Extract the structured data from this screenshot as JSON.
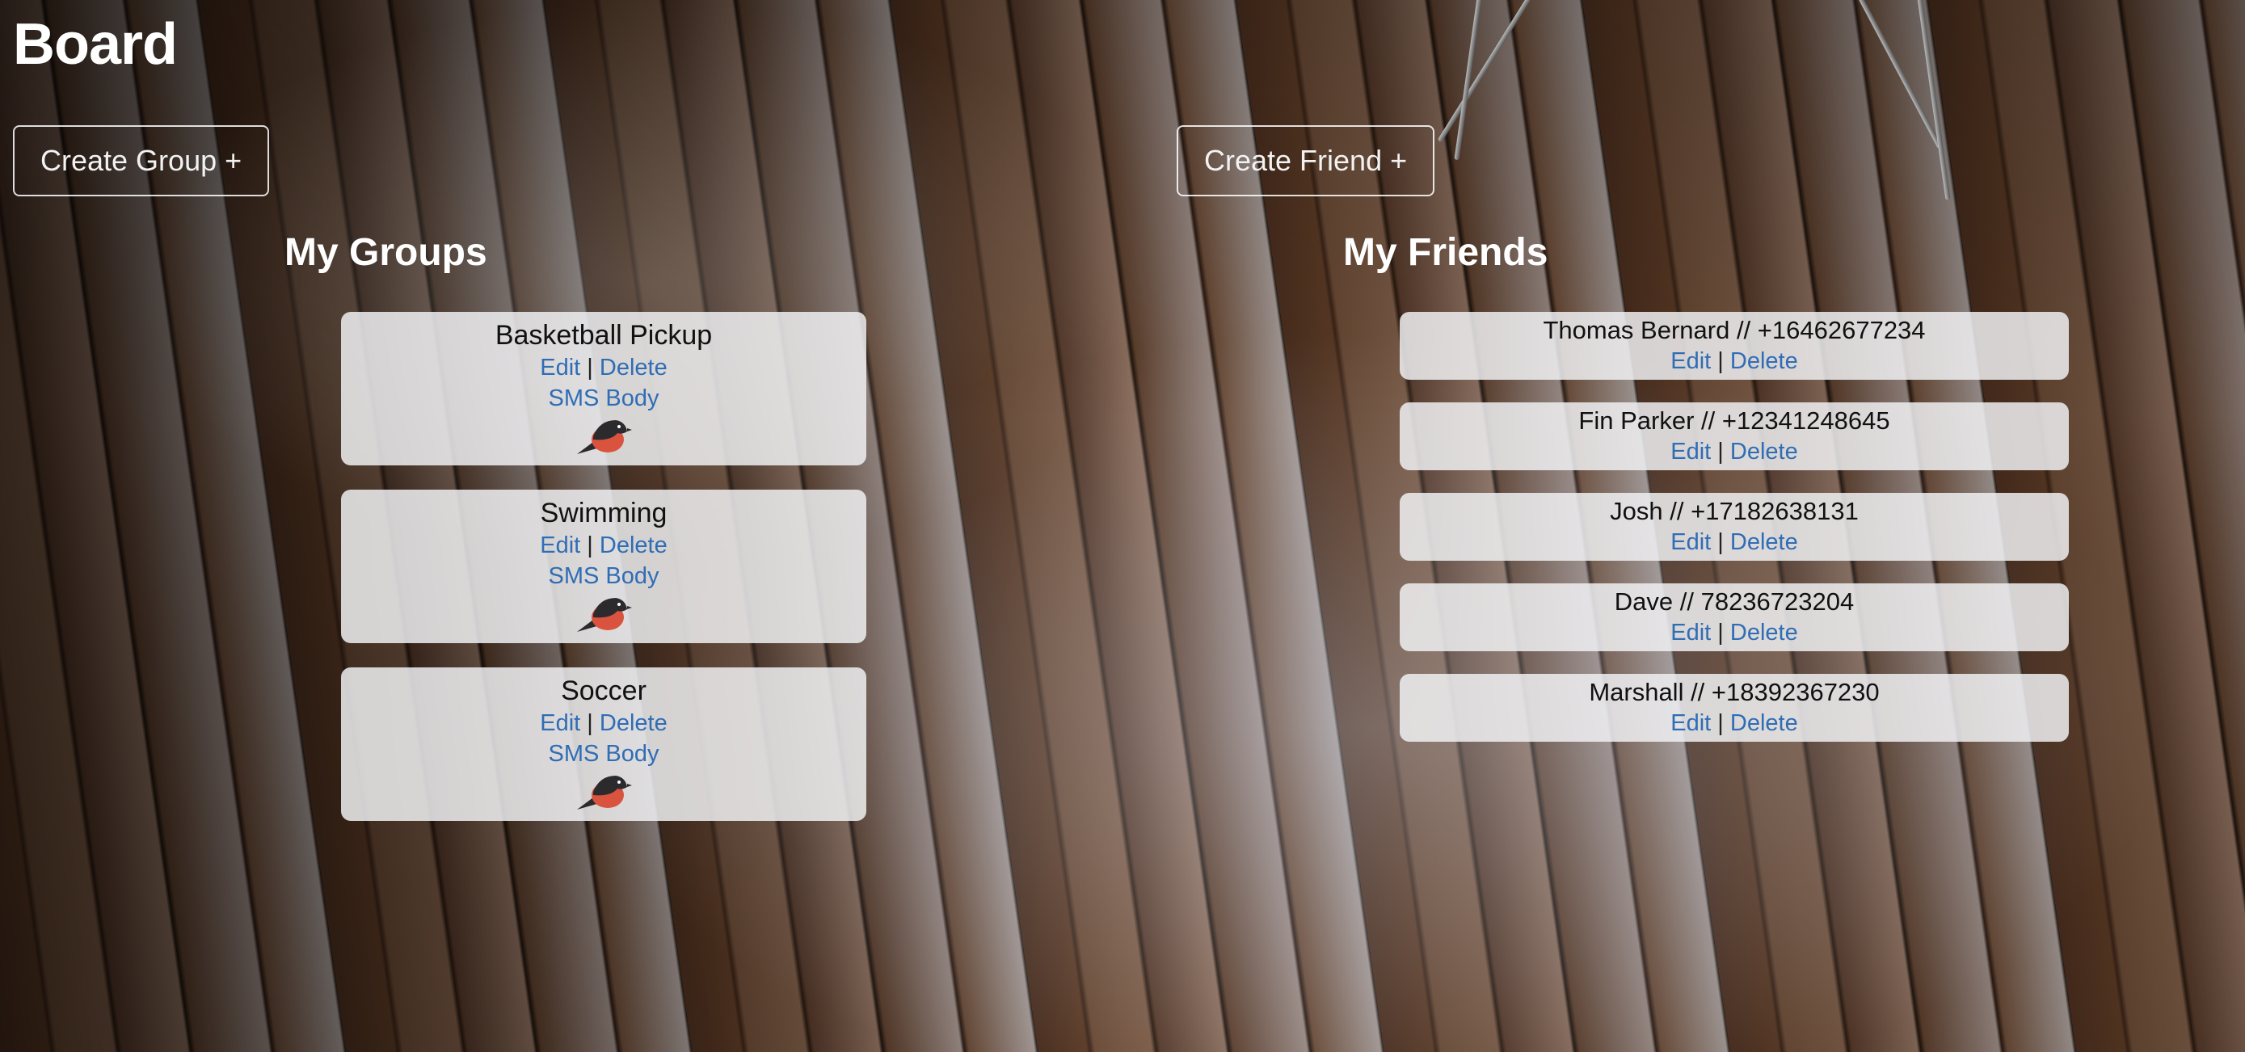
{
  "app": {
    "title": "Board"
  },
  "toolbar": {
    "create_group_label": "Create Group +",
    "create_friend_label": "Create Friend +"
  },
  "groups": {
    "heading": "My Groups",
    "items": [
      {
        "name": "Basketball Pickup",
        "edit": "Edit",
        "separator": "|",
        "delete": "Delete",
        "sms": "SMS Body",
        "icon": "bird-icon"
      },
      {
        "name": "Swimming",
        "edit": "Edit",
        "separator": "|",
        "delete": "Delete",
        "sms": "SMS Body",
        "icon": "bird-icon"
      },
      {
        "name": "Soccer",
        "edit": "Edit",
        "separator": "|",
        "delete": "Delete",
        "sms": "SMS Body",
        "icon": "bird-icon"
      }
    ]
  },
  "friends": {
    "heading": "My Friends",
    "items": [
      {
        "label": "Thomas Bernard // +16462677234",
        "edit": "Edit",
        "separator": "|",
        "delete": "Delete"
      },
      {
        "label": "Fin Parker // +12341248645",
        "edit": "Edit",
        "separator": "|",
        "delete": "Delete"
      },
      {
        "label": "Josh // +17182638131",
        "edit": "Edit",
        "separator": "|",
        "delete": "Delete"
      },
      {
        "label": "Dave // 78236723204",
        "edit": "Edit",
        "separator": "|",
        "delete": "Delete"
      },
      {
        "label": "Marshall // +18392367230",
        "edit": "Edit",
        "separator": "|",
        "delete": "Delete"
      }
    ]
  },
  "colors": {
    "link": "#2f6db5",
    "card_background": "#f0f0f2",
    "bird_body": "#2b2b2e",
    "bird_breast": "#d9533f"
  }
}
